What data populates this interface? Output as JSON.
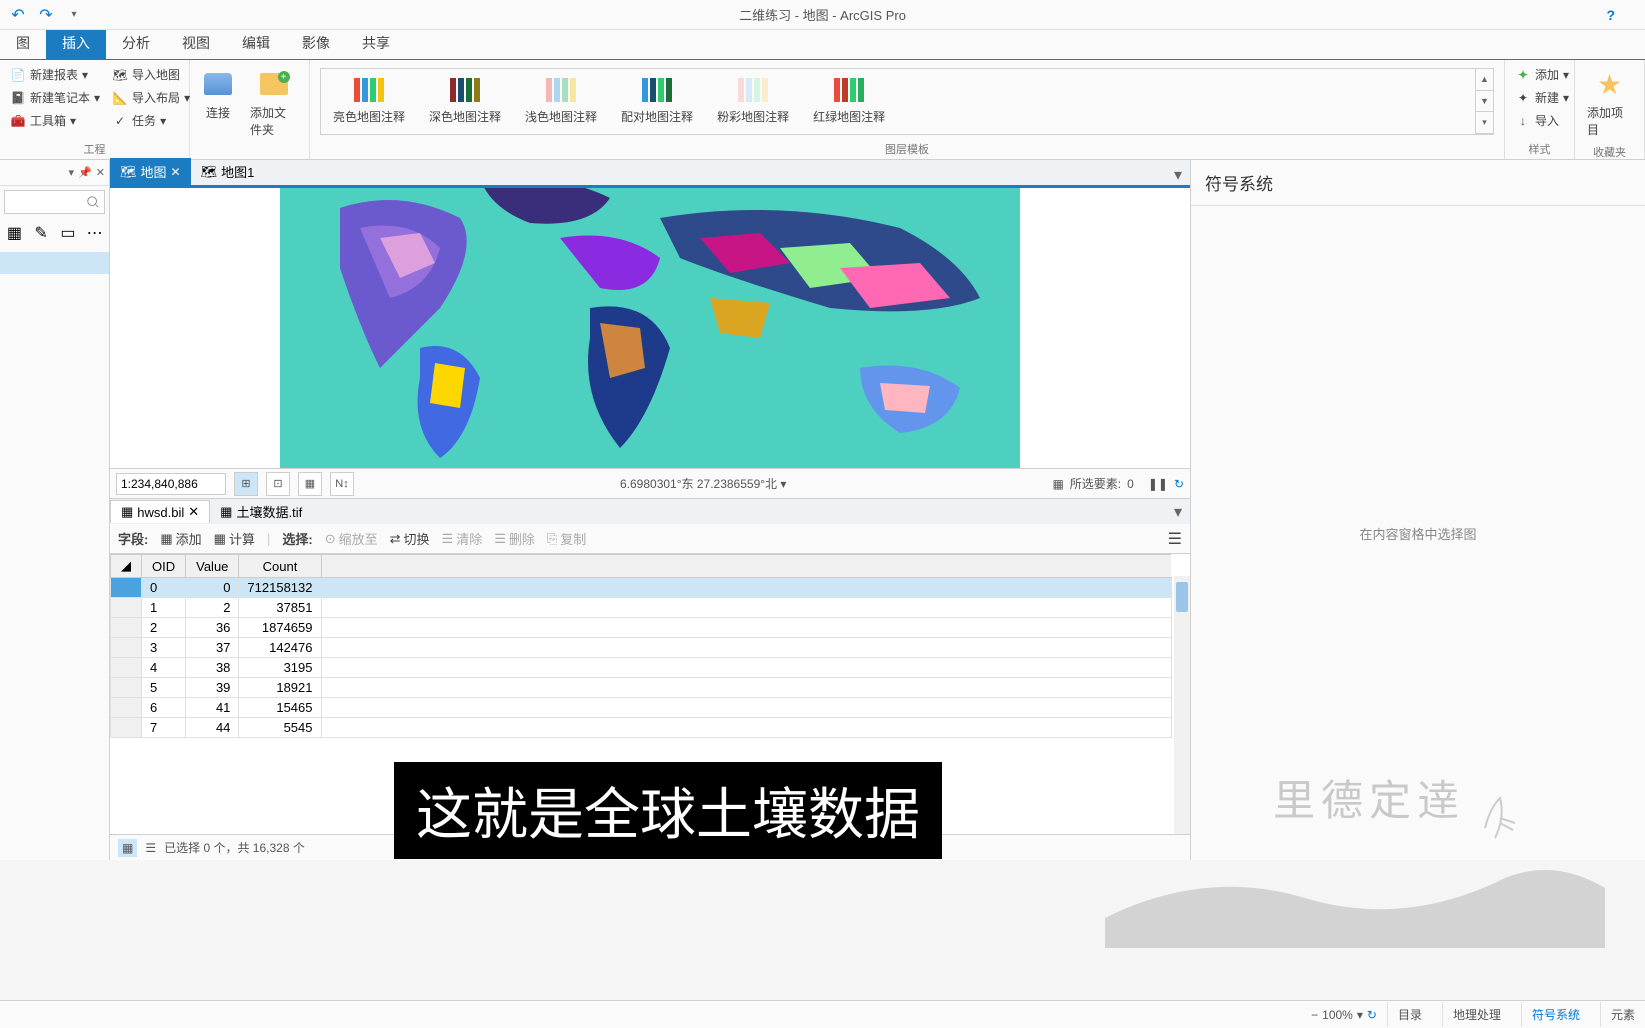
{
  "title": "二维练习 - 地图 - ArcGIS Pro",
  "ribbon_tabs": [
    "图",
    "插入",
    "分析",
    "视图",
    "编辑",
    "影像",
    "共享"
  ],
  "ribbon": {
    "project": {
      "new_report": "新建报表",
      "new_notebook": "新建笔记本",
      "toolbox": "工具箱",
      "import_map": "导入地图",
      "import_layout": "导入布局",
      "tasks": "任务",
      "connect": "连接",
      "add_folder": "添加文件夹",
      "label": "工程"
    },
    "templates": {
      "label": "图层模板",
      "items": [
        "亮色地图注释",
        "深色地图注释",
        "浅色地图注释",
        "配对地图注释",
        "粉彩地图注释",
        "红绿地图注释"
      ]
    },
    "styles": {
      "add": "添加",
      "new": "新建",
      "import": "导入",
      "label": "样式"
    },
    "favorites": {
      "add_item": "添加项目",
      "label": "收藏夹"
    }
  },
  "doc_tabs": {
    "active": "地图",
    "other": "地图1"
  },
  "map_status": {
    "scale": "1:234,840,886",
    "coords": "6.6980301°东 27.2386559°北",
    "selected_label": "所选要素:",
    "selected_count": "0"
  },
  "table_tabs": {
    "active": "hwsd.bil",
    "other": "土壤数据.tif"
  },
  "table_toolbar": {
    "fields_label": "字段:",
    "add": "添加",
    "calculate": "计算",
    "select_label": "选择:",
    "zoom_to": "缩放至",
    "switch": "切换",
    "clear": "清除",
    "delete": "删除",
    "copy": "复制"
  },
  "table": {
    "columns": [
      "OID",
      "Value",
      "Count"
    ],
    "rows": [
      {
        "oid": "0",
        "value": "0",
        "count": "712158132"
      },
      {
        "oid": "1",
        "value": "2",
        "count": "37851"
      },
      {
        "oid": "2",
        "value": "36",
        "count": "1874659"
      },
      {
        "oid": "3",
        "value": "37",
        "count": "142476"
      },
      {
        "oid": "4",
        "value": "38",
        "count": "3195"
      },
      {
        "oid": "5",
        "value": "39",
        "count": "18921"
      },
      {
        "oid": "6",
        "value": "41",
        "count": "15465"
      },
      {
        "oid": "7",
        "value": "44",
        "count": "5545"
      }
    ]
  },
  "table_footer": "已选择 0 个，共 16,328 个",
  "right_panel": {
    "title": "符号系统",
    "hint": "在内容窗格中选择图"
  },
  "bottom_bar": {
    "zoom": "100%",
    "tabs": [
      "目录",
      "地理处理",
      "符号系统",
      "元素"
    ]
  },
  "subtitle": "这就是全球土壤数据",
  "watermark": "里德定逹"
}
